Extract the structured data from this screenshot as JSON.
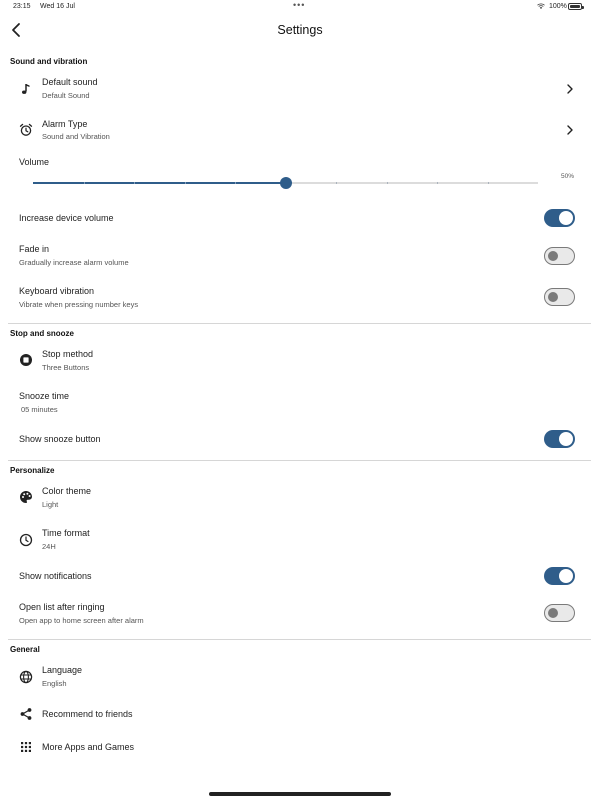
{
  "status_bar": {
    "time": "23:15",
    "date": "Wed 16 Jul",
    "dots": "•••",
    "battery": "100%"
  },
  "header": {
    "title": "Settings"
  },
  "sections": {
    "sound": {
      "header": "Sound and vibration",
      "default_sound": {
        "title": "Default sound",
        "subtitle": "Default Sound",
        "icon": "music-note-icon"
      },
      "alarm_type": {
        "title": "Alarm Type",
        "subtitle": "Sound and Vibration",
        "icon": "alarm-clock-icon"
      },
      "volume": {
        "label": "Volume",
        "value_label": "50%",
        "value": 0.5
      },
      "increase_volume": {
        "title": "Increase device volume",
        "on": true
      },
      "fade_in": {
        "title": "Fade in",
        "subtitle": "Gradually increase alarm volume",
        "on": false
      },
      "keyboard_vibration": {
        "title": "Keyboard vibration",
        "subtitle": "Vibrate when pressing number keys",
        "on": false
      }
    },
    "snooze": {
      "header": "Stop and snooze",
      "stop_method": {
        "title": "Stop method",
        "subtitle": "Three Buttons",
        "icon": "stop-icon"
      },
      "snooze_time": {
        "title": "Snooze time",
        "subtitle": "05 minutes"
      },
      "show_snooze": {
        "title": "Show snooze button",
        "on": true
      }
    },
    "personalize": {
      "header": "Personalize",
      "color_theme": {
        "title": "Color theme",
        "subtitle": "Light",
        "icon": "palette-icon"
      },
      "time_format": {
        "title": "Time format",
        "subtitle": "24H",
        "icon": "clock-icon"
      },
      "show_notifications": {
        "title": "Show notifications",
        "on": true
      },
      "open_list": {
        "title": "Open list after ringing",
        "subtitle": "Open app to home screen after alarm",
        "on": false
      }
    },
    "general": {
      "header": "General",
      "language": {
        "title": "Language",
        "subtitle": "English",
        "icon": "globe-icon"
      },
      "recommend": {
        "title": "Recommend to friends",
        "icon": "share-icon"
      },
      "more_apps": {
        "title": "More Apps and Games",
        "icon": "grid-icon"
      }
    }
  },
  "colors": {
    "accent": "#2f5d8a",
    "toggle_off": "#7a7a7a",
    "divider": "#d6d6d6"
  }
}
